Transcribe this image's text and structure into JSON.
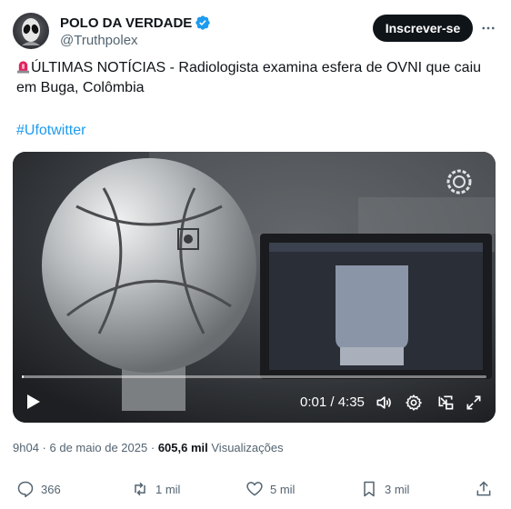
{
  "author": {
    "display_name": "POLO DA VERDADE",
    "handle": "@Truthpolex"
  },
  "header": {
    "follow_label": "Inscrever-se"
  },
  "tweet": {
    "text": "ÚLTIMAS NOTÍCIAS - Radiologista examina esfera de OVNI que caiu em Buga, Colômbia",
    "hashtag": "#Ufotwitter"
  },
  "video": {
    "time": "0:01 / 4:35",
    "progress_fraction": 0.004
  },
  "meta": {
    "time": "9h04",
    "date": "6 de maio de 2025",
    "separator": "·",
    "views_count": "605,6 mil",
    "views_label": "Visualizações"
  },
  "actions": {
    "replies": "366",
    "reposts": "1 mil",
    "likes": "5 mil",
    "bookmarks": "3 mil"
  },
  "colors": {
    "accent": "#1d9bf0",
    "text": "#0f1419",
    "secondary": "#536471",
    "verified": "#1d9bf0"
  }
}
